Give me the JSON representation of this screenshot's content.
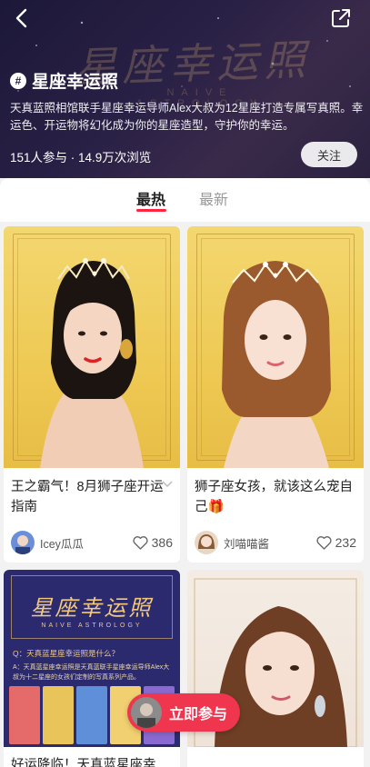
{
  "header": {
    "watermark_title": "星座幸运照",
    "watermark_sub": "NAIVE ASTROLOGY",
    "topic_title": "星座幸运照",
    "topic_description": "天真蓝照相馆联手星座幸运导师Alex大叔为12星座打造专属写真照。幸运色、开运物将幻化成为你的星座造型，守护你的幸运。",
    "stats": "151人参与 · 14.9万次浏览",
    "follow_label": "关注"
  },
  "tabs": [
    {
      "label": "最热",
      "active": true
    },
    {
      "label": "最新",
      "active": false
    }
  ],
  "posts": [
    {
      "title": "王之霸气！8月狮子座开运指南",
      "author": "Icey瓜瓜",
      "likes": "386"
    },
    {
      "title": "狮子座女孩，就该这么宠自己🎁",
      "author": "刘喵喵酱",
      "likes": "232"
    },
    {
      "title": "好运降临！天真蓝星座幸",
      "poster_title": "星座幸运照",
      "poster_sub": "NAIVE ASTROLOGY",
      "poster_q": "Q：天真蓝星座幸运照是什么？",
      "poster_a": "A：天真蓝星座幸运照是天真蓝联手星座幸运导师Alex大叔为十二星座的女孩们定制的写真系列产品。"
    },
    {
      "title": ""
    }
  ],
  "join_button": {
    "label": "立即参与"
  },
  "colors": {
    "accent": "#ff2442",
    "header_bg": "#2a2146",
    "join_bg": "#f0354f"
  }
}
